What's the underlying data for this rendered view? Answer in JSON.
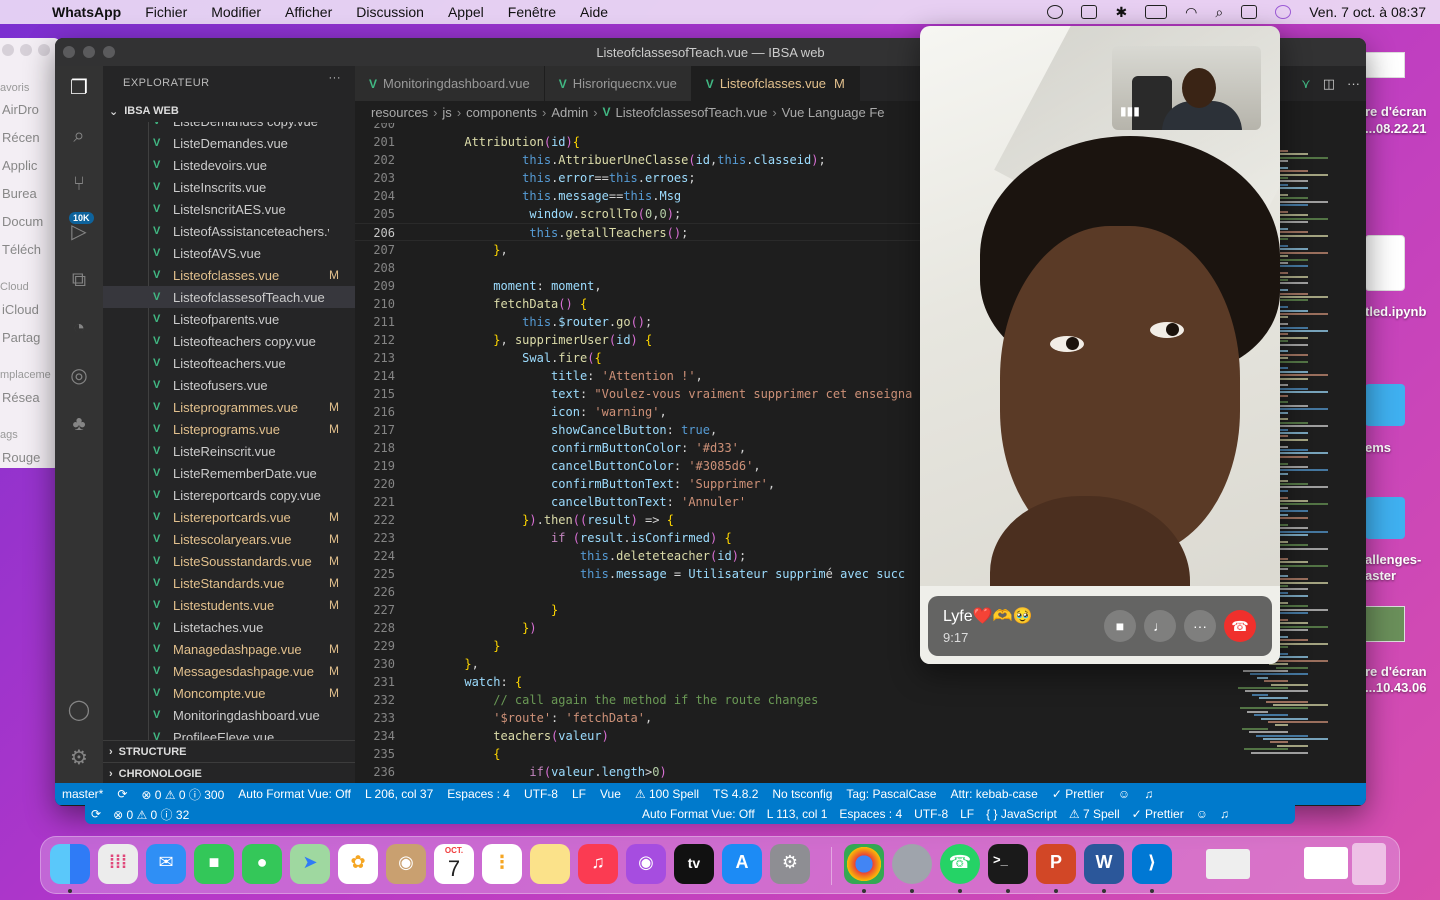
{
  "menubar": {
    "app": "WhatsApp",
    "items": [
      "Fichier",
      "Modifier",
      "Afficher",
      "Discussion",
      "Appel",
      "Fenêtre",
      "Aide"
    ],
    "datetime": "Ven. 7 oct. à  08:37"
  },
  "finder": {
    "headings": [
      "avoris",
      "Cloud",
      "mplaceme",
      "ags"
    ],
    "items": [
      "AirDro",
      "Récen",
      "Applic",
      "Burea",
      "Docum",
      "Téléch",
      "iCloud",
      "Partag",
      "Résea",
      "Rouge"
    ]
  },
  "desktop": {
    "labels": [
      "re d'écran",
      "...08.22.21",
      "tled.ipynb",
      "ems",
      "allenges-",
      "aster",
      "re d'écran",
      "...10.43.06"
    ]
  },
  "vscode": {
    "title": "ListeofclassesofTeach.vue — IBSA web",
    "explorer_title": "EXPLORATEUR",
    "explorer_more": "···",
    "project": "IBSA WEB",
    "activity_badge": "10K",
    "files": [
      {
        "name": "ListeDemandes copy.vue",
        "status": ""
      },
      {
        "name": "ListeDemandes.vue",
        "status": ""
      },
      {
        "name": "Listedevoirs.vue",
        "status": ""
      },
      {
        "name": "ListeInscrits.vue",
        "status": ""
      },
      {
        "name": "ListeIsncritAES.vue",
        "status": ""
      },
      {
        "name": "ListeofAssistanceteachers.vue",
        "status": ""
      },
      {
        "name": "ListeofAVS.vue",
        "status": ""
      },
      {
        "name": "Listeofclasses.vue",
        "status": "M"
      },
      {
        "name": "ListeofclassesofTeach.vue",
        "status": ""
      },
      {
        "name": "Listeofparents.vue",
        "status": ""
      },
      {
        "name": "Listeofteachers copy.vue",
        "status": ""
      },
      {
        "name": "Listeofteachers.vue",
        "status": ""
      },
      {
        "name": "Listeofusers.vue",
        "status": ""
      },
      {
        "name": "Listeprogrammes.vue",
        "status": "M"
      },
      {
        "name": "Listeprograms.vue",
        "status": "M"
      },
      {
        "name": "ListeReinscrit.vue",
        "status": ""
      },
      {
        "name": "ListeRememberDate.vue",
        "status": ""
      },
      {
        "name": "Listereportcards copy.vue",
        "status": ""
      },
      {
        "name": "Listereportcards.vue",
        "status": "M"
      },
      {
        "name": "Listescolaryears.vue",
        "status": "M"
      },
      {
        "name": "ListeSousstandards.vue",
        "status": "M"
      },
      {
        "name": "ListeStandards.vue",
        "status": "M"
      },
      {
        "name": "Listestudents.vue",
        "status": "M"
      },
      {
        "name": "Listetaches.vue",
        "status": ""
      },
      {
        "name": "Managedashpage.vue",
        "status": "M"
      },
      {
        "name": "Messagesdashpage.vue",
        "status": "M"
      },
      {
        "name": "Moncompte.vue",
        "status": "M"
      },
      {
        "name": "Monitoringdashboard.vue",
        "status": ""
      },
      {
        "name": "ProfileeEleve.vue",
        "status": ""
      }
    ],
    "selected_file": "ListeofclassesofTeach.vue",
    "sections": [
      "STRUCTURE",
      "CHRONOLOGIE"
    ],
    "tabs": [
      {
        "label": "Monitoringdashboard.vue",
        "mod": ""
      },
      {
        "label": "Hisroriquecnx.vue",
        "mod": ""
      },
      {
        "label": "Listeofclasses.vue",
        "mod": "M"
      }
    ],
    "tab_overflow": "ttribution",
    "breadcrumbs": [
      "resources",
      "js",
      "components",
      "Admin",
      "ListeofclassesofTeach.vue",
      "Vue Language Fe"
    ],
    "current_line": "206",
    "code_lines": [
      {
        "n": "200",
        "t": ""
      },
      {
        "n": "201",
        "t": "      Attribution(id){"
      },
      {
        "n": "202",
        "t": "              this.AttribuerUneClasse(id,this.classeid);"
      },
      {
        "n": "203",
        "t": "              this.error==this.erroes;"
      },
      {
        "n": "204",
        "t": "              this.message==this.Msg"
      },
      {
        "n": "205",
        "t": "               window.scrollTo(0,0);"
      },
      {
        "n": "206",
        "t": "               this.getallTeachers();"
      },
      {
        "n": "207",
        "t": "          },"
      },
      {
        "n": "208",
        "t": ""
      },
      {
        "n": "209",
        "t": "          moment: moment,"
      },
      {
        "n": "210",
        "t": "          fetchData() {"
      },
      {
        "n": "211",
        "t": "              this.$router.go();"
      },
      {
        "n": "212",
        "t": "          }, supprimerUser(id) {"
      },
      {
        "n": "213",
        "t": "              Swal.fire({"
      },
      {
        "n": "214",
        "t": "                  title: 'Attention !',"
      },
      {
        "n": "215",
        "t": "                  text: \"Voulez-vous vraiment supprimer cet enseigna"
      },
      {
        "n": "216",
        "t": "                  icon: 'warning',"
      },
      {
        "n": "217",
        "t": "                  showCancelButton: true,"
      },
      {
        "n": "218",
        "t": "                  confirmButtonColor: '#d33',"
      },
      {
        "n": "219",
        "t": "                  cancelButtonColor: '#3085d6',"
      },
      {
        "n": "220",
        "t": "                  confirmButtonText: 'Supprimer',"
      },
      {
        "n": "221",
        "t": "                  cancelButtonText: 'Annuler'"
      },
      {
        "n": "222",
        "t": "              }).then((result) => {"
      },
      {
        "n": "223",
        "t": "                  if (result.isConfirmed) {"
      },
      {
        "n": "224",
        "t": "                      this.deleteteacher(id);"
      },
      {
        "n": "225",
        "t": "                      this.message = 'Utilisateur supprimé avec succ"
      },
      {
        "n": "226",
        "t": ""
      },
      {
        "n": "227",
        "t": "                  }"
      },
      {
        "n": "228",
        "t": "              })"
      },
      {
        "n": "229",
        "t": "          }"
      },
      {
        "n": "230",
        "t": "      },"
      },
      {
        "n": "231",
        "t": "      watch: {"
      },
      {
        "n": "232",
        "t": "          // call again the method if the route changes"
      },
      {
        "n": "233",
        "t": "          '$route': 'fetchData',"
      },
      {
        "n": "234",
        "t": "          teachers(valeur)"
      },
      {
        "n": "235",
        "t": "          {"
      },
      {
        "n": "236",
        "t": "               if(valeur.length>0)"
      }
    ],
    "status": [
      "master*",
      "⟳",
      "⊗ 0 ⚠ 0 ⓘ 300",
      "Auto Format Vue: Off",
      "L 206, col 37",
      "Espaces : 4",
      "UTF-8",
      "LF",
      "Vue",
      "⚠ 100 Spell",
      "TS 4.8.2",
      "No tsconfig",
      "Tag: PascalCase",
      "Attr: kebab-case",
      "✓ Prettier"
    ],
    "status2": [
      "⊗ 0 ⚠ 0 ⓘ 32",
      "Auto Format Vue: Off",
      "L 113, col 1",
      "Espaces : 4",
      "UTF-8",
      "LF",
      "{ } JavaScript",
      "⚠ 7 Spell",
      "✓ Prettier"
    ]
  },
  "facetime": {
    "caller": "Lyfe❤️🫶🥹",
    "duration": "9:17"
  },
  "dock": {
    "calendar_month": "OCT.",
    "calendar_day": "7",
    "tv_label": "tv"
  },
  "colors": {
    "vscode_blue": "#007acc",
    "vue_green": "#41b883",
    "modified": "#e2c08d",
    "end_call": "#f0302c"
  }
}
